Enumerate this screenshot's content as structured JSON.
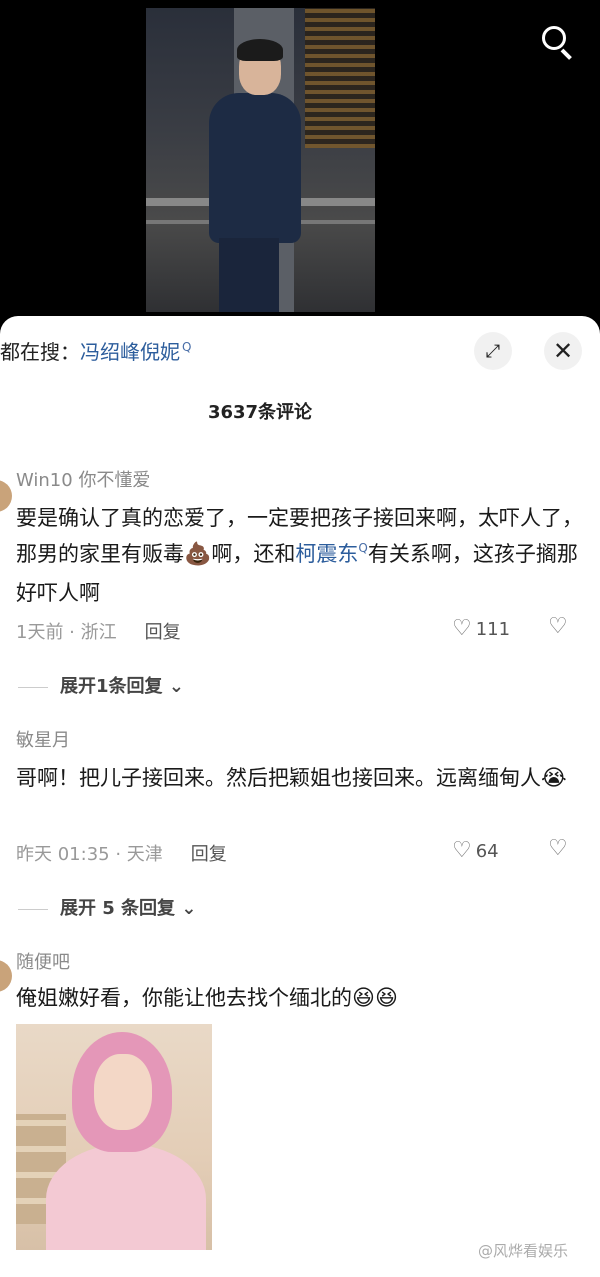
{
  "header": {
    "search_icon": "search-icon"
  },
  "sheet": {
    "everyone_search_prefix": "都在搜：",
    "everyone_search_term": "冯绍峰倪妮",
    "everyone_search_mark": "Q",
    "expand_icon": "⤢",
    "close_icon": "✕",
    "comment_count": "3637条评论"
  },
  "comments": [
    {
      "username": "Win10 你不懂爱",
      "text_part1": "要是确认了真的恋爱了，一定要把孩子接回来啊，太吓人了，那男的家里有贩毒",
      "emoji1": "💩",
      "text_part2": "啊，还和",
      "link": "柯震东",
      "link_mark": "Q",
      "text_part3": "有关系啊，这孩子搁那好吓人啊",
      "time_location": "1天前 · 浙江",
      "reply_label": "回复",
      "likes": "111",
      "expand_label": "展开1条回复",
      "expand_chevron": "⌄"
    },
    {
      "username": "敏星月",
      "text_part1": "哥啊！把儿子接回来。然后把颖姐也接回来。远离缅甸人",
      "emoji1": "😭",
      "time_location": "昨天 01:35 · 天津",
      "reply_label": "回复",
      "likes": "64",
      "expand_label": "展开 5 条回复",
      "expand_chevron": "⌄"
    },
    {
      "username": "随便吧",
      "text_part1": "俺姐嫩好看，你能让他去找个缅北的",
      "emoji1": "😆",
      "emoji2": "😆"
    }
  ],
  "watermark": "@风烨看娱乐"
}
